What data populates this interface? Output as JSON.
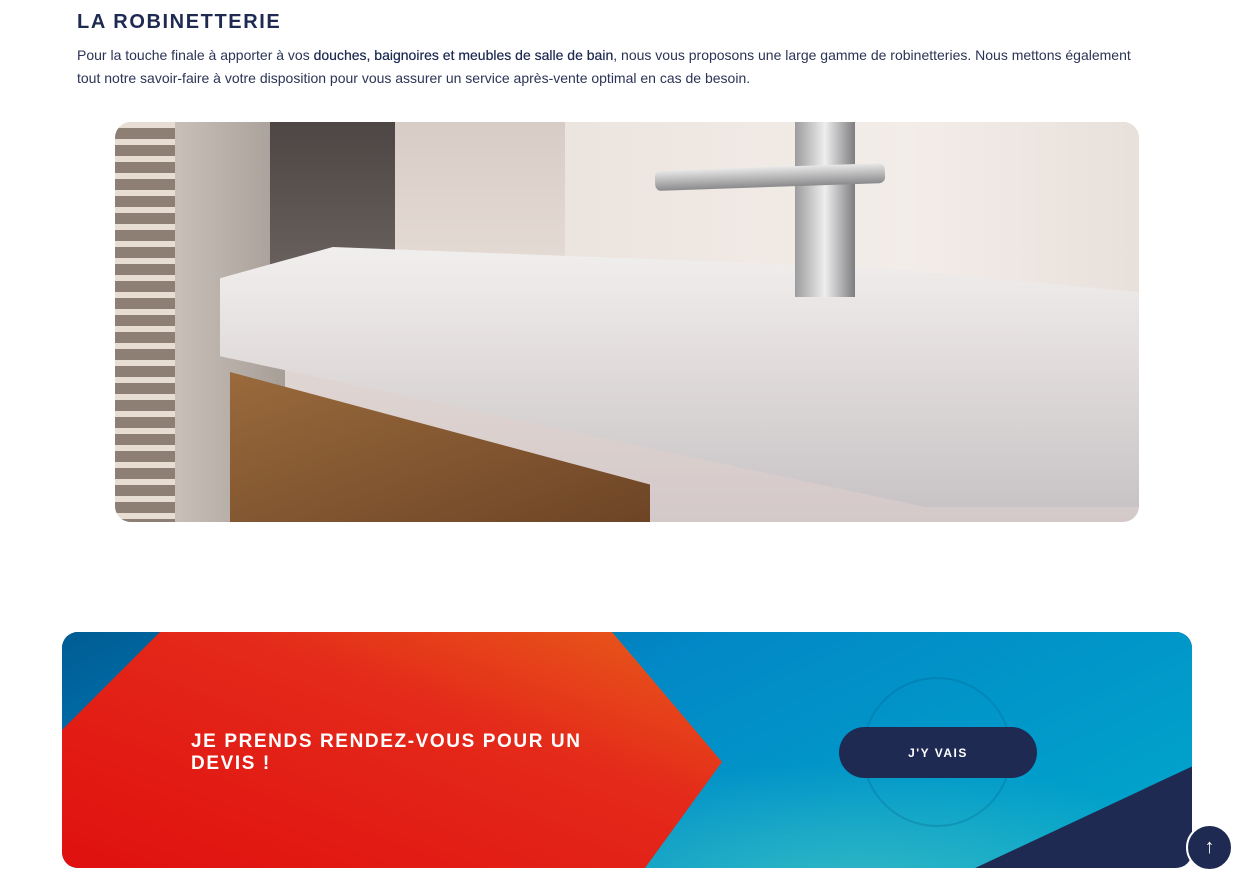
{
  "section": {
    "title": "LA ROBINETTERIE",
    "intro_before": "Pour la touche finale à apporter à vos ",
    "intro_bold": "douches, baignoires et meubles de salle de bain",
    "intro_after": ", nous vous proposons une large gamme de robinetteries. Nous mettons également tout notre savoir-faire à votre disposition pour vous assurer un service après-vente optimal en cas de besoin."
  },
  "banner": {
    "text": "JE PRENDS RENDEZ-VOUS POUR UN DEVIS !",
    "button_label": "J'Y VAIS"
  },
  "scroll_top": {
    "icon": "arrow-up-icon",
    "glyph": "↑"
  },
  "colors": {
    "navy": "#1e2a52",
    "red": "#e0100f",
    "blue": "#0288c6"
  }
}
